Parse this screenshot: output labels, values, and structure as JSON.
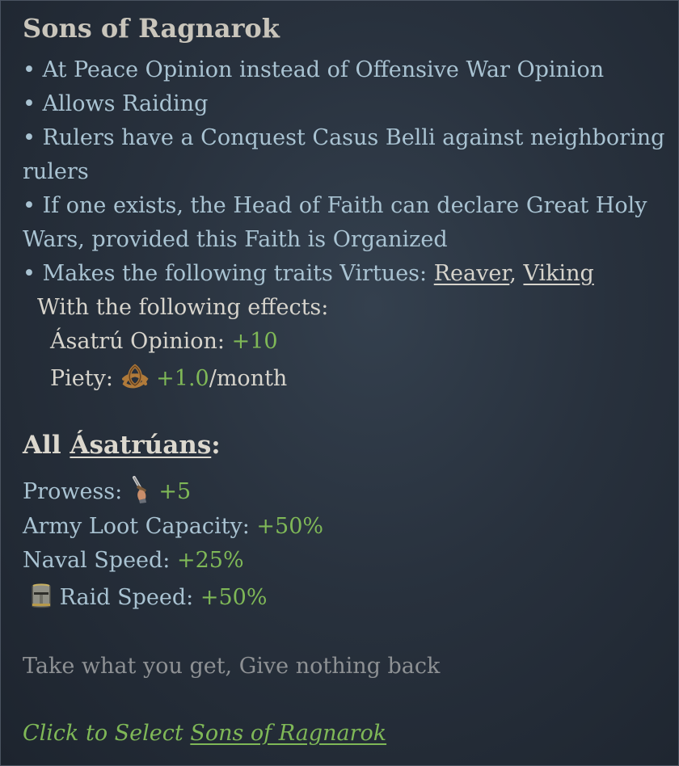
{
  "title": "Sons of Ragnarok",
  "bullets": {
    "b1": "• At Peace Opinion instead of Offensive War Opinion",
    "b2": "• Allows Raiding",
    "b3a": "• Rulers have a Conquest Casus Belli against neighboring",
    "b3b": "rulers",
    "b4a": "• If one exists, the Head of Faith can declare Great Holy",
    "b4b": "Wars, provided this Faith is Organized",
    "b5_prefix": "• Makes the following traits Virtues: ",
    "trait1": "Reaver",
    "trait_sep": ", ",
    "trait2": "Viking"
  },
  "effects": {
    "intro": "With the following effects:",
    "opinion_label": "Ásatrú Opinion: ",
    "opinion_value": "+10",
    "piety_label": "Piety: ",
    "piety_value": "+1.0",
    "piety_unit": "/month",
    "piety_icon": "piety-icon"
  },
  "all_section": {
    "prefix": "All ",
    "group": "Ásatrúans",
    "colon": ":",
    "prowess_label": "Prowess: ",
    "prowess_value": "+5",
    "prowess_icon": "prowess-icon",
    "loot_label": "Army Loot Capacity: ",
    "loot_value": "+50%",
    "naval_label": "Naval Speed: ",
    "naval_value": "+25%",
    "raid_label": "Raid Speed: ",
    "raid_value": "+50%",
    "raid_icon": "helmet-icon"
  },
  "flavor": "Take what you get, Give nothing back",
  "action": {
    "prefix": "Click to Select ",
    "target": "Sons of Ragnarok"
  },
  "colors": {
    "positive": "#7fb857",
    "keyword": "#a9c3d2",
    "flavor": "#8e9194"
  }
}
